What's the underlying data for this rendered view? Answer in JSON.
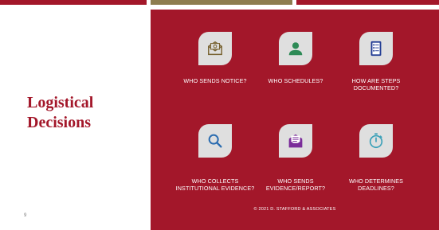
{
  "slide": {
    "title": "Logistical Decisions",
    "number": "9",
    "footer": "© 2021 D. STAFFORD & ASSOCIATES"
  },
  "items": [
    {
      "label": "WHO SENDS NOTICE?",
      "icon": "envelope-at-icon",
      "icon_color": "#7a6535"
    },
    {
      "label": "WHO SCHEDULES?",
      "icon": "person-icon",
      "icon_color": "#2e8b57"
    },
    {
      "label": "HOW ARE STEPS DOCUMENTED?",
      "icon": "checklist-icon",
      "icon_color": "#1f3a93"
    },
    {
      "label": "WHO COLLECTS INSTITUTIONAL EVIDENCE?",
      "icon": "magnifier-icon",
      "icon_color": "#2b6cb0"
    },
    {
      "label": "WHO SENDS EVIDENCE/REPORT?",
      "icon": "envelope-letter-icon",
      "icon_color": "#7b2d9a"
    },
    {
      "label": "WHO DETERMINES DEADLINES?",
      "icon": "stopwatch-icon",
      "icon_color": "#3aa0b8"
    }
  ],
  "colors": {
    "accent": "#a3172a",
    "gold": "#8d7d4f",
    "tile": "#dfdfdf"
  }
}
